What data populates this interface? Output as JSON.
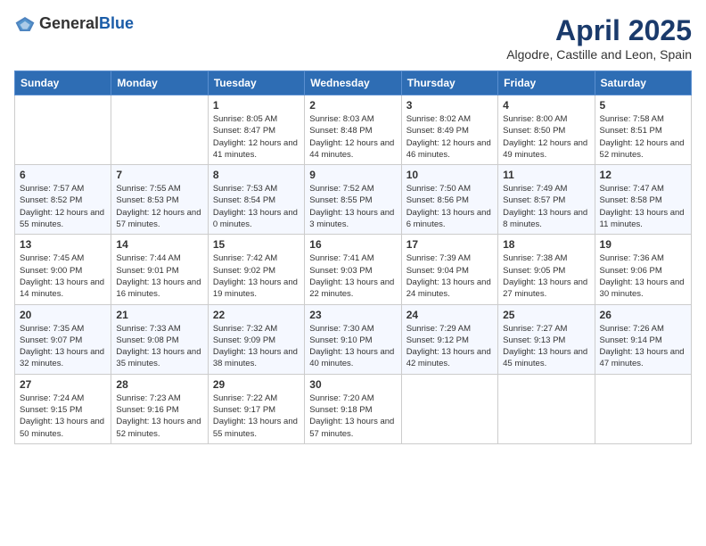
{
  "header": {
    "logo_general": "General",
    "logo_blue": "Blue",
    "title": "April 2025",
    "subtitle": "Algodre, Castille and Leon, Spain"
  },
  "days_of_week": [
    "Sunday",
    "Monday",
    "Tuesday",
    "Wednesday",
    "Thursday",
    "Friday",
    "Saturday"
  ],
  "weeks": [
    [
      {
        "day": "",
        "sunrise": "",
        "sunset": "",
        "daylight": ""
      },
      {
        "day": "",
        "sunrise": "",
        "sunset": "",
        "daylight": ""
      },
      {
        "day": "1",
        "sunrise": "Sunrise: 8:05 AM",
        "sunset": "Sunset: 8:47 PM",
        "daylight": "Daylight: 12 hours and 41 minutes."
      },
      {
        "day": "2",
        "sunrise": "Sunrise: 8:03 AM",
        "sunset": "Sunset: 8:48 PM",
        "daylight": "Daylight: 12 hours and 44 minutes."
      },
      {
        "day": "3",
        "sunrise": "Sunrise: 8:02 AM",
        "sunset": "Sunset: 8:49 PM",
        "daylight": "Daylight: 12 hours and 46 minutes."
      },
      {
        "day": "4",
        "sunrise": "Sunrise: 8:00 AM",
        "sunset": "Sunset: 8:50 PM",
        "daylight": "Daylight: 12 hours and 49 minutes."
      },
      {
        "day": "5",
        "sunrise": "Sunrise: 7:58 AM",
        "sunset": "Sunset: 8:51 PM",
        "daylight": "Daylight: 12 hours and 52 minutes."
      }
    ],
    [
      {
        "day": "6",
        "sunrise": "Sunrise: 7:57 AM",
        "sunset": "Sunset: 8:52 PM",
        "daylight": "Daylight: 12 hours and 55 minutes."
      },
      {
        "day": "7",
        "sunrise": "Sunrise: 7:55 AM",
        "sunset": "Sunset: 8:53 PM",
        "daylight": "Daylight: 12 hours and 57 minutes."
      },
      {
        "day": "8",
        "sunrise": "Sunrise: 7:53 AM",
        "sunset": "Sunset: 8:54 PM",
        "daylight": "Daylight: 13 hours and 0 minutes."
      },
      {
        "day": "9",
        "sunrise": "Sunrise: 7:52 AM",
        "sunset": "Sunset: 8:55 PM",
        "daylight": "Daylight: 13 hours and 3 minutes."
      },
      {
        "day": "10",
        "sunrise": "Sunrise: 7:50 AM",
        "sunset": "Sunset: 8:56 PM",
        "daylight": "Daylight: 13 hours and 6 minutes."
      },
      {
        "day": "11",
        "sunrise": "Sunrise: 7:49 AM",
        "sunset": "Sunset: 8:57 PM",
        "daylight": "Daylight: 13 hours and 8 minutes."
      },
      {
        "day": "12",
        "sunrise": "Sunrise: 7:47 AM",
        "sunset": "Sunset: 8:58 PM",
        "daylight": "Daylight: 13 hours and 11 minutes."
      }
    ],
    [
      {
        "day": "13",
        "sunrise": "Sunrise: 7:45 AM",
        "sunset": "Sunset: 9:00 PM",
        "daylight": "Daylight: 13 hours and 14 minutes."
      },
      {
        "day": "14",
        "sunrise": "Sunrise: 7:44 AM",
        "sunset": "Sunset: 9:01 PM",
        "daylight": "Daylight: 13 hours and 16 minutes."
      },
      {
        "day": "15",
        "sunrise": "Sunrise: 7:42 AM",
        "sunset": "Sunset: 9:02 PM",
        "daylight": "Daylight: 13 hours and 19 minutes."
      },
      {
        "day": "16",
        "sunrise": "Sunrise: 7:41 AM",
        "sunset": "Sunset: 9:03 PM",
        "daylight": "Daylight: 13 hours and 22 minutes."
      },
      {
        "day": "17",
        "sunrise": "Sunrise: 7:39 AM",
        "sunset": "Sunset: 9:04 PM",
        "daylight": "Daylight: 13 hours and 24 minutes."
      },
      {
        "day": "18",
        "sunrise": "Sunrise: 7:38 AM",
        "sunset": "Sunset: 9:05 PM",
        "daylight": "Daylight: 13 hours and 27 minutes."
      },
      {
        "day": "19",
        "sunrise": "Sunrise: 7:36 AM",
        "sunset": "Sunset: 9:06 PM",
        "daylight": "Daylight: 13 hours and 30 minutes."
      }
    ],
    [
      {
        "day": "20",
        "sunrise": "Sunrise: 7:35 AM",
        "sunset": "Sunset: 9:07 PM",
        "daylight": "Daylight: 13 hours and 32 minutes."
      },
      {
        "day": "21",
        "sunrise": "Sunrise: 7:33 AM",
        "sunset": "Sunset: 9:08 PM",
        "daylight": "Daylight: 13 hours and 35 minutes."
      },
      {
        "day": "22",
        "sunrise": "Sunrise: 7:32 AM",
        "sunset": "Sunset: 9:09 PM",
        "daylight": "Daylight: 13 hours and 38 minutes."
      },
      {
        "day": "23",
        "sunrise": "Sunrise: 7:30 AM",
        "sunset": "Sunset: 9:10 PM",
        "daylight": "Daylight: 13 hours and 40 minutes."
      },
      {
        "day": "24",
        "sunrise": "Sunrise: 7:29 AM",
        "sunset": "Sunset: 9:12 PM",
        "daylight": "Daylight: 13 hours and 42 minutes."
      },
      {
        "day": "25",
        "sunrise": "Sunrise: 7:27 AM",
        "sunset": "Sunset: 9:13 PM",
        "daylight": "Daylight: 13 hours and 45 minutes."
      },
      {
        "day": "26",
        "sunrise": "Sunrise: 7:26 AM",
        "sunset": "Sunset: 9:14 PM",
        "daylight": "Daylight: 13 hours and 47 minutes."
      }
    ],
    [
      {
        "day": "27",
        "sunrise": "Sunrise: 7:24 AM",
        "sunset": "Sunset: 9:15 PM",
        "daylight": "Daylight: 13 hours and 50 minutes."
      },
      {
        "day": "28",
        "sunrise": "Sunrise: 7:23 AM",
        "sunset": "Sunset: 9:16 PM",
        "daylight": "Daylight: 13 hours and 52 minutes."
      },
      {
        "day": "29",
        "sunrise": "Sunrise: 7:22 AM",
        "sunset": "Sunset: 9:17 PM",
        "daylight": "Daylight: 13 hours and 55 minutes."
      },
      {
        "day": "30",
        "sunrise": "Sunrise: 7:20 AM",
        "sunset": "Sunset: 9:18 PM",
        "daylight": "Daylight: 13 hours and 57 minutes."
      },
      {
        "day": "",
        "sunrise": "",
        "sunset": "",
        "daylight": ""
      },
      {
        "day": "",
        "sunrise": "",
        "sunset": "",
        "daylight": ""
      },
      {
        "day": "",
        "sunrise": "",
        "sunset": "",
        "daylight": ""
      }
    ]
  ]
}
